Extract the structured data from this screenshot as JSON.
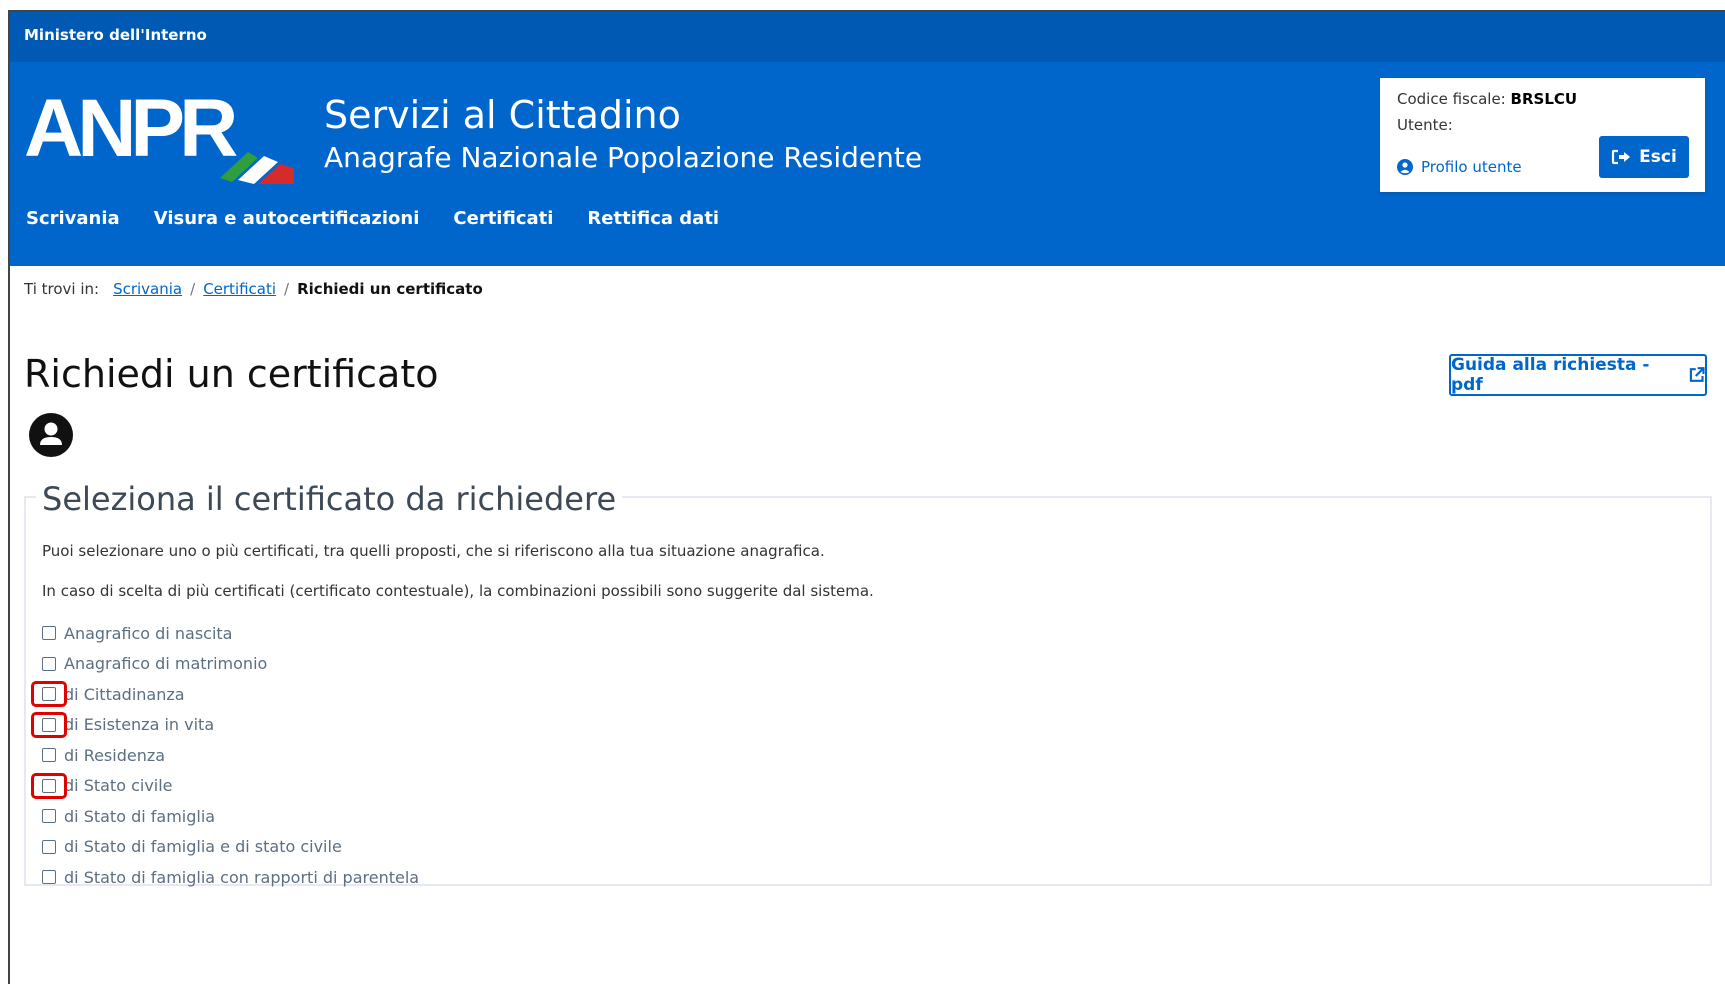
{
  "slim_header": {
    "label": "Ministero dell'Interno"
  },
  "brand": {
    "logo_text": "ANPR",
    "title": "Servizi al Cittadino",
    "subtitle": "Anagrafe Nazionale Popolazione Residente"
  },
  "user": {
    "cf_label": "Codice fiscale:",
    "cf_value": "BRSLCU",
    "utente_label": "Utente:",
    "profilo_label": "Profilo utente",
    "esci_label": "Esci"
  },
  "nav": [
    "Scrivania",
    "Visura e autocertificazioni",
    "Certificati",
    "Rettifica dati"
  ],
  "breadcrumb": {
    "label": "Ti trovi in:",
    "items": [
      "Scrivania",
      "Certificati"
    ],
    "current": "Richiedi un certificato"
  },
  "page": {
    "title": "Richiedi un certificato",
    "guida_label": "Guida alla richiesta - pdf"
  },
  "section": {
    "legend": "Seleziona il certificato da richiedere",
    "p1": "Puoi selezionare uno o più certificati, tra quelli proposti, che si riferiscono alla tua situazione anagrafica.",
    "p2": "In caso di scelta di più certificati (certificato contestuale), la combinazioni possibili sono suggerite dal sistema.",
    "options": [
      "Anagrafico di nascita",
      "Anagrafico di matrimonio",
      "di Cittadinanza",
      "di Esistenza in vita",
      "di Residenza",
      "di Stato civile",
      "di Stato di famiglia",
      "di Stato di famiglia e di stato civile",
      "di Stato di famiglia con rapporti di parentela"
    ]
  },
  "colors": {
    "primary": "#0066cc",
    "slim": "#0059b3",
    "highlight": "#e00000"
  }
}
